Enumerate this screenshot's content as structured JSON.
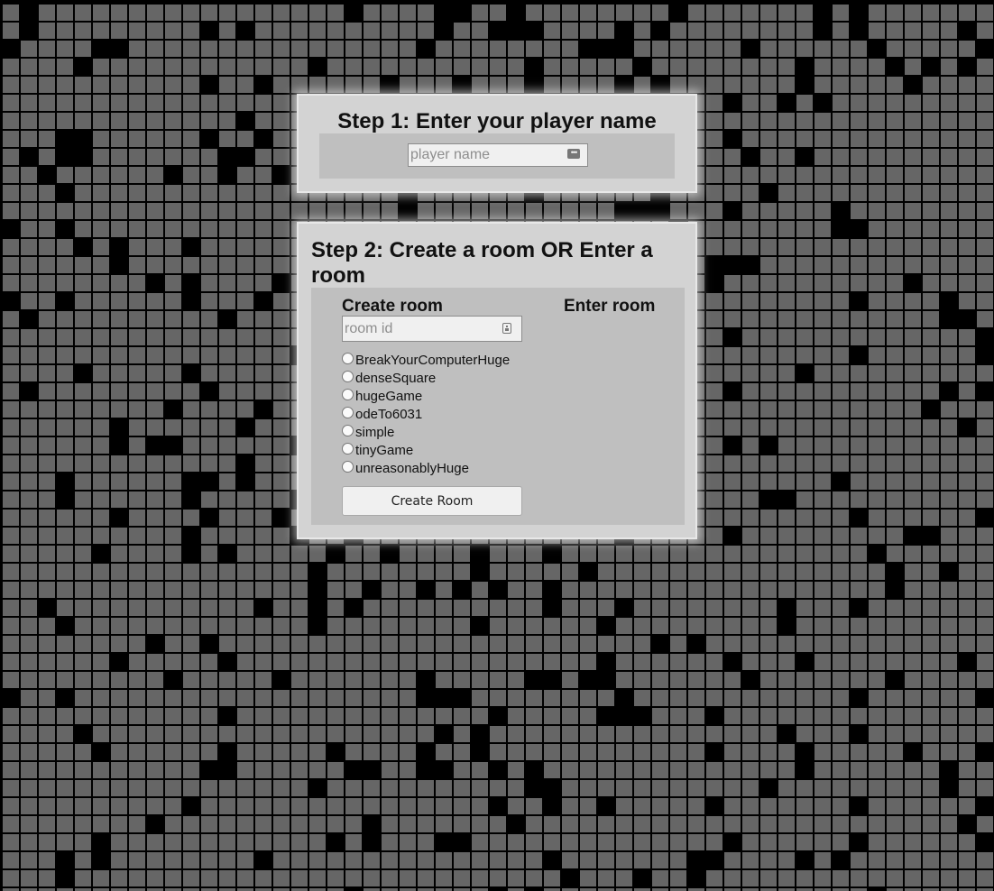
{
  "step1": {
    "title": "Step 1: Enter your player name",
    "player_name_placeholder": "player name",
    "player_name_value": ""
  },
  "step2": {
    "title": "Step 2: Create a room OR Enter a room",
    "create": {
      "heading": "Create room",
      "room_id_placeholder": "room id",
      "room_id_value": "",
      "maps": [
        {
          "label": "BreakYourComputerHuge",
          "selected": false
        },
        {
          "label": "denseSquare",
          "selected": false
        },
        {
          "label": "hugeGame",
          "selected": false
        },
        {
          "label": "odeTo6031",
          "selected": false
        },
        {
          "label": "simple",
          "selected": false
        },
        {
          "label": "tinyGame",
          "selected": false
        },
        {
          "label": "unreasonablyHuge",
          "selected": false
        }
      ],
      "button_label": "Create Room"
    },
    "enter": {
      "heading": "Enter room"
    }
  },
  "icons": {
    "player_name_field": "password-manager-icon",
    "room_id_field": "contact-card-icon"
  },
  "colors": {
    "panel_bg": "#d3d3d3",
    "inner_bg": "#bfbfbf",
    "grid_cell": "#666666",
    "grid_line": "#000000"
  }
}
